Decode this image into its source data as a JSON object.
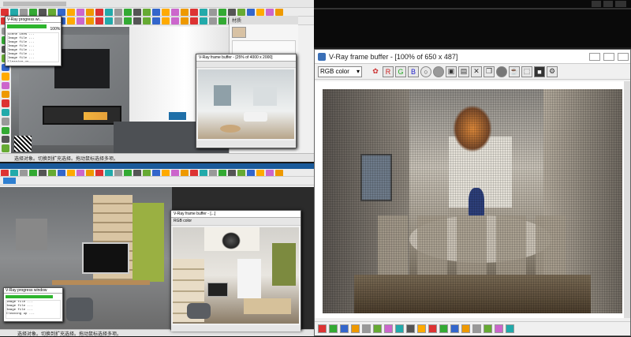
{
  "top_sketchup": {
    "title": "",
    "status_text": "选择对象。切换到扩充选择。拖动鼠标选择多项。",
    "materials_panel_title": "材质"
  },
  "vray_progress_top": {
    "title": "V-Ray progress wi...",
    "percent": "100%",
    "log_lines": [
      "Scene 100% ...",
      "Image file ...",
      "Image file ...",
      "Image file ...",
      "Image file ...",
      "Image file ...",
      "Image file ...",
      "Cleaning up ..."
    ]
  },
  "vfb_small": {
    "title": "V-Ray frame buffer - [25% of 4000 x 2000]"
  },
  "vfb_main": {
    "title": "V-Ray frame buffer - [100% of 650 x 487]",
    "channel": "RGB color",
    "r": "R",
    "g": "G",
    "b": "B"
  },
  "bottom_sketchup": {
    "status_text": "选择对象。切换到扩充选择。拖动鼠标选择多项。",
    "sidebar_label": "名称"
  },
  "vfb_bottom": {
    "title": "V-Ray frame buffer - [...]",
    "channel": "RGB color"
  },
  "vray_progress_bottom": {
    "title": "V-Ray progress window",
    "log_lines": [
      "Image file ...",
      "Image file ...",
      "Image file ...",
      "Cleaning up ..."
    ]
  }
}
